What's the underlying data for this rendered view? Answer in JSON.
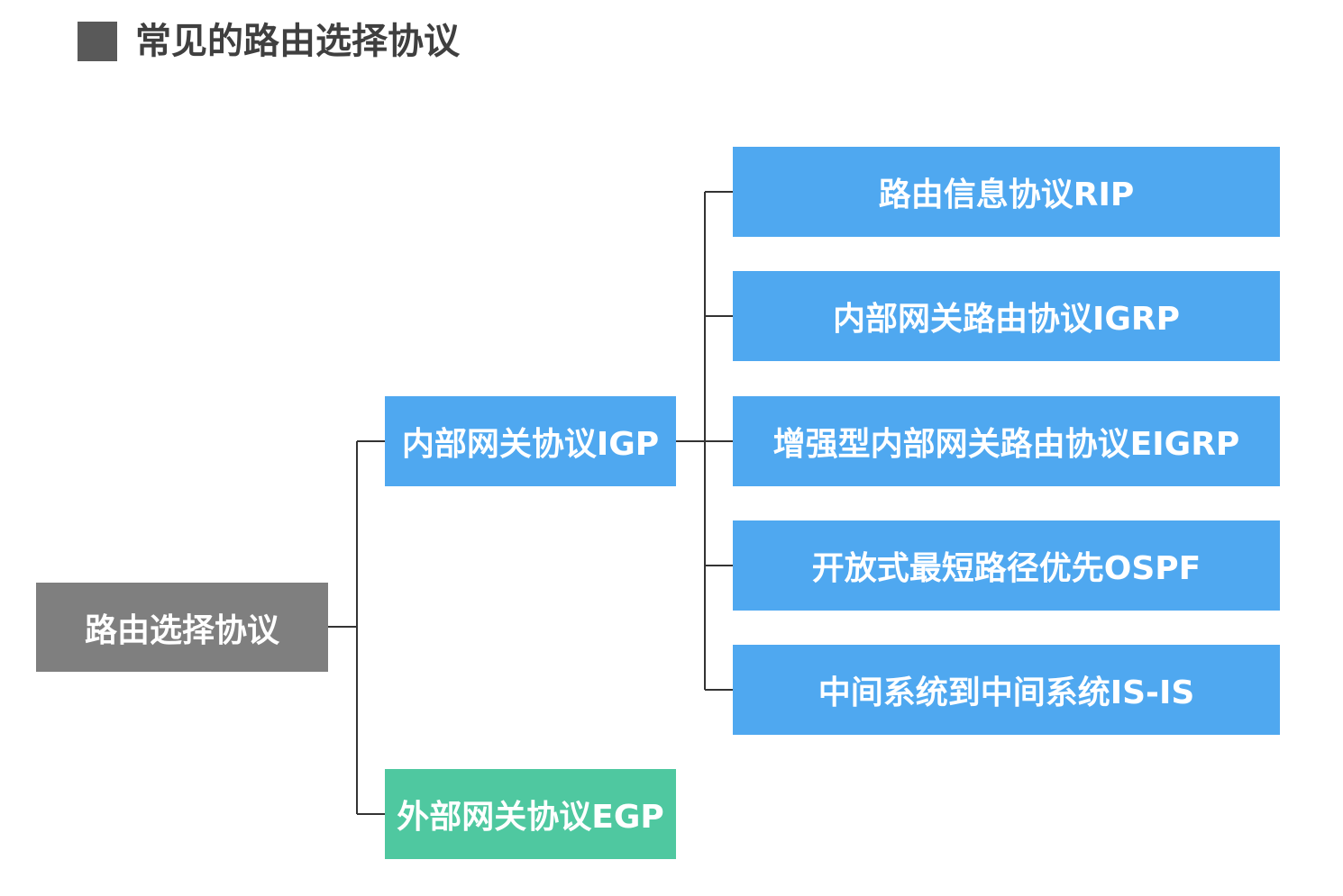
{
  "header": {
    "title": "常见的路由选择协议"
  },
  "diagram": {
    "root": "路由选择协议",
    "igp": "内部网关协议IGP",
    "egp": "外部网关协议EGP",
    "igp_children": [
      "路由信息协议RIP",
      "内部网关路由协议IGRP",
      "增强型内部网关路由协议EIGRP",
      "开放式最短路径优先OSPF",
      "中间系统到中间系统IS-IS"
    ]
  },
  "colors": {
    "root": "#7f7f7f",
    "igp": "#4fa8f0",
    "egp": "#4fc8a0",
    "leaf": "#4fa8f0",
    "connector": "#333333",
    "title": "#3f3f3f"
  }
}
